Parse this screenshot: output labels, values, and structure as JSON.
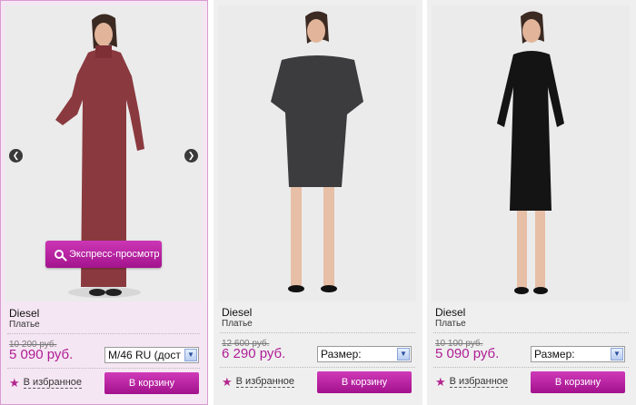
{
  "products": [
    {
      "brand": "Diesel",
      "type": "Платье",
      "old_price": "10 200 руб.",
      "price": "5 090 руб.",
      "size_value": "M/46 RU (дост",
      "quick_view_label": "Экспресс-просмотр",
      "favorite_label": "В избранное",
      "cart_label": "В корзину",
      "dress_color": "#8a3a3f"
    },
    {
      "brand": "Diesel",
      "type": "Платье",
      "old_price": "12 600 руб.",
      "price": "6 290 руб.",
      "size_value": "Размер:",
      "favorite_label": "В избранное",
      "cart_label": "В корзину",
      "dress_color": "#3c3c3f"
    },
    {
      "brand": "Diesel",
      "type": "Платье",
      "old_price": "10 100 руб.",
      "price": "5 090 руб.",
      "size_value": "Размер:",
      "favorite_label": "В избранное",
      "cart_label": "В корзину",
      "dress_color": "#141414"
    }
  ],
  "icons": {
    "prev": "chevron-left-icon",
    "next": "chevron-right-icon",
    "search": "magnifier-icon",
    "favorite": "star-icon",
    "dropdown": "chevron-down-icon"
  },
  "colors": {
    "accent": "#b01d96",
    "button": "#b81fa0",
    "active_card_bg": "#f5e6f3"
  }
}
